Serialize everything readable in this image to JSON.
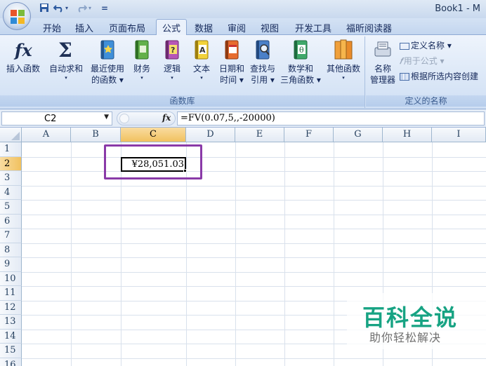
{
  "title_bar": {
    "title": "Book1 - M"
  },
  "quick_access": {
    "save_icon": "save-icon",
    "undo_icon": "undo-icon",
    "redo_icon": "redo-icon",
    "customize_glyph": "="
  },
  "tabs": [
    {
      "label": "开始"
    },
    {
      "label": "插入"
    },
    {
      "label": "页面布局"
    },
    {
      "label": "公式",
      "active": true
    },
    {
      "label": "数据"
    },
    {
      "label": "审阅"
    },
    {
      "label": "视图"
    },
    {
      "label": "开发工具"
    },
    {
      "label": "福昕阅读器"
    }
  ],
  "ribbon": {
    "function_library": {
      "label": "函数库",
      "buttons": [
        {
          "line1": "插入函数",
          "line2": "",
          "icon": "fx-icon"
        },
        {
          "line1": "自动求和",
          "line2": "▾",
          "icon": "sigma-icon"
        },
        {
          "line1": "最近使用",
          "line2": "的函数 ▾",
          "icon": "recent-book-icon"
        },
        {
          "line1": "财务",
          "line2": "▾",
          "icon": "finance-book-icon"
        },
        {
          "line1": "逻辑",
          "line2": "▾",
          "icon": "logic-book-icon"
        },
        {
          "line1": "文本",
          "line2": "▾",
          "icon": "text-book-icon"
        },
        {
          "line1": "日期和",
          "line2": "时间 ▾",
          "icon": "datetime-book-icon"
        },
        {
          "line1": "查找与",
          "line2": "引用 ▾",
          "icon": "lookup-book-icon"
        },
        {
          "line1": "数学和",
          "line2": "三角函数 ▾",
          "icon": "math-book-icon"
        },
        {
          "line1": "其他函数",
          "line2": "▾",
          "icon": "more-books-icon"
        }
      ]
    },
    "defined_names": {
      "label": "定义的名称",
      "name_manager": {
        "line1": "名称",
        "line2": "管理器"
      },
      "define_name": "定义名称 ▾",
      "use_in_formula": "用于公式 ▾",
      "create_from_selection": "根据所选内容创建"
    }
  },
  "formula_bar": {
    "name_box": "C2",
    "fx_label": "fx",
    "formula": "=FV(0.07,5,,-20000)"
  },
  "grid": {
    "columns": [
      "A",
      "B",
      "C",
      "D",
      "E",
      "F",
      "G",
      "H",
      "I"
    ],
    "rows": [
      "1",
      "2",
      "3",
      "4",
      "5",
      "6",
      "7",
      "8",
      "9",
      "10",
      "11",
      "12",
      "13",
      "14",
      "15",
      "16"
    ],
    "selected_cell": "C2",
    "selected_value": "¥28,051.03"
  },
  "watermark": {
    "title": "百科全说",
    "subtitle": "助你轻松解决"
  },
  "colors": {
    "accent": "#17a383",
    "highlight": "#8a3aa8",
    "selected_header": "#f1c15f"
  }
}
